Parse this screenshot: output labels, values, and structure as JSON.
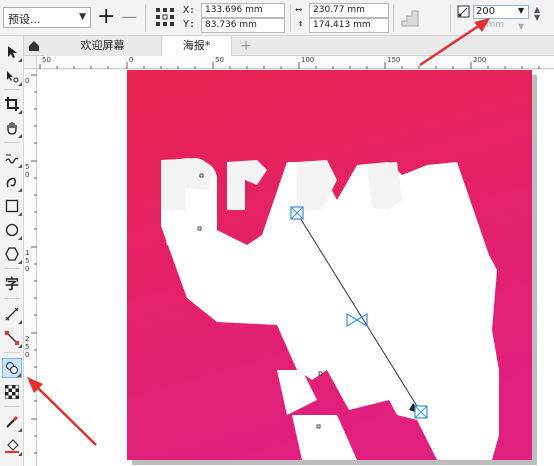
{
  "propbar": {
    "preset_value": "预设...",
    "add_symbol": "+",
    "remove_symbol": "—",
    "x_label": "X:",
    "y_label": "Y:",
    "x_value": "133.696 mm",
    "y_value": "83.736 mm",
    "w_value": "230.77 mm",
    "h_value": "174.413 mm",
    "steps_value": "200",
    "steps_secondary": ".0 mm"
  },
  "tabs": {
    "welcome": "欢迎屏幕",
    "poster": "海报*",
    "add": "+"
  },
  "hruler_labels": [
    "50",
    "0",
    "50",
    "100",
    "150",
    "200"
  ],
  "vruler_labels": [
    "0",
    "5",
    "0",
    "1",
    "5",
    "0",
    "2",
    "5",
    "0"
  ],
  "colors": {
    "poster_top": "#e8234f",
    "poster_bottom": "#e01f7e",
    "arrow_red": "#e03030",
    "selection_blue": "#3a8fd6"
  },
  "toolbox": [
    "pick-tool",
    "shape-tool",
    "crop-tool",
    "pan-tool",
    "freehand-tool",
    "artistic-media-tool",
    "rectangle-tool",
    "ellipse-tool",
    "polygon-tool",
    "text-tool",
    "parallel-dimension-tool",
    "connector-tool",
    "blend-tool",
    "transparency-tool",
    "eyedropper-tool",
    "fill-tool"
  ],
  "text_glyph": "字"
}
